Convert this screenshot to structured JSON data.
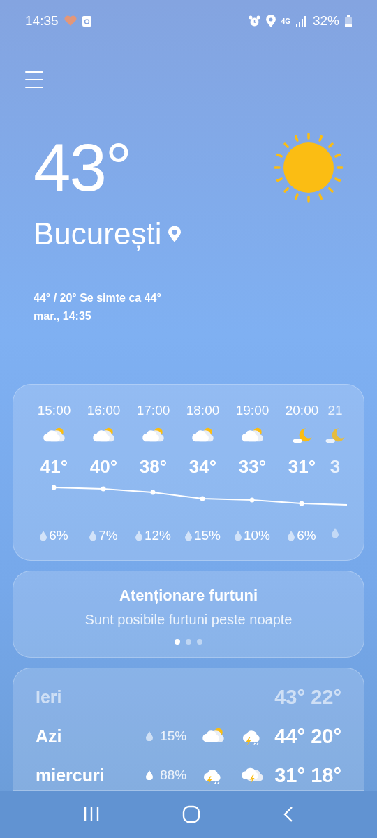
{
  "status_bar": {
    "time": "14:35",
    "network": "4G",
    "battery": "32%"
  },
  "current": {
    "temperature": "43°",
    "city": "București",
    "summary": "44° / 20° Se simte ca 44°",
    "date_time": "mar., 14:35"
  },
  "hourly": [
    {
      "kind": "full",
      "time": "15:00",
      "temperature": "41°",
      "precipitation": "6%"
    },
    {
      "kind": "full",
      "time": "16:00",
      "temperature": "40°",
      "precipitation": "7%"
    },
    {
      "kind": "full",
      "time": "17:00",
      "temperature": "38°",
      "precipitation": "12%"
    },
    {
      "kind": "full",
      "time": "18:00",
      "temperature": "34°",
      "precipitation": "15%"
    },
    {
      "kind": "full",
      "time": "19:00",
      "temperature": "33°",
      "precipitation": "10%"
    },
    {
      "kind": "full",
      "time": "20:00",
      "temperature": "31°",
      "precipitation": "6%"
    },
    {
      "kind": "partial",
      "time": "21",
      "temperature": "3"
    }
  ],
  "alert": {
    "title": "Atenționare furtuni",
    "text": "Sunt posibile furtuni peste noapte",
    "pages": [
      {
        "selected": true
      },
      {
        "selected": false
      },
      {
        "selected": false
      }
    ]
  },
  "daily": [
    {
      "kind": "past",
      "day": "Ieri",
      "high": "43°",
      "low": "22°"
    },
    {
      "kind": "day",
      "day": "Azi",
      "precipitation": "15%",
      "high": "44°",
      "low": "20°"
    },
    {
      "kind": "day",
      "day": "miercuri",
      "precipitation": "88%",
      "high": "31°",
      "low": "18°"
    }
  ],
  "nav": [
    {
      "kind": "recents"
    },
    {
      "kind": "home"
    },
    {
      "kind": "back"
    }
  ]
}
